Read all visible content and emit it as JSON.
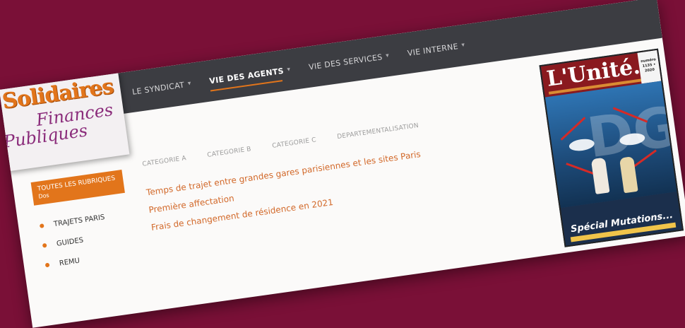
{
  "logo": {
    "line1": "Solidaires",
    "line2": "Finances",
    "line3": "Publiques"
  },
  "nav": {
    "items": [
      {
        "label": "LE SYNDICAT",
        "has_dropdown": true,
        "active": false
      },
      {
        "label": "VIE DES AGENTS",
        "has_dropdown": true,
        "active": true
      },
      {
        "label": "VIE DES SERVICES",
        "has_dropdown": true,
        "active": false
      },
      {
        "label": "VIE INTERNE",
        "has_dropdown": true,
        "active": false
      }
    ]
  },
  "sidebar": {
    "header": "TOUTES LES RUBRIQUES",
    "header_sub": "Dos",
    "items": [
      {
        "label": "TRAJETS PARIS"
      },
      {
        "label": "GUIDES"
      },
      {
        "label": "REMU"
      }
    ]
  },
  "subtabs": [
    {
      "label": "CATEGORIE A"
    },
    {
      "label": "CATEGORIE B"
    },
    {
      "label": "CATEGORIE C"
    },
    {
      "label": "DEPARTEMENTALISATION"
    }
  ],
  "articles": [
    {
      "title": "Temps de trajet entre grandes gares parisiennes et les sites Paris"
    },
    {
      "title": "Première affectation"
    },
    {
      "title": "Frais de changement de résidence en 2021"
    }
  ],
  "magazine": {
    "title": "L'Unité...",
    "badge": "numéro 1135 • 2020",
    "special": "Spécial Mutations..."
  },
  "colors": {
    "background": "#7a1037",
    "navbar": "#3c3d42",
    "accent": "#e2751b",
    "link": "#d2692a"
  }
}
